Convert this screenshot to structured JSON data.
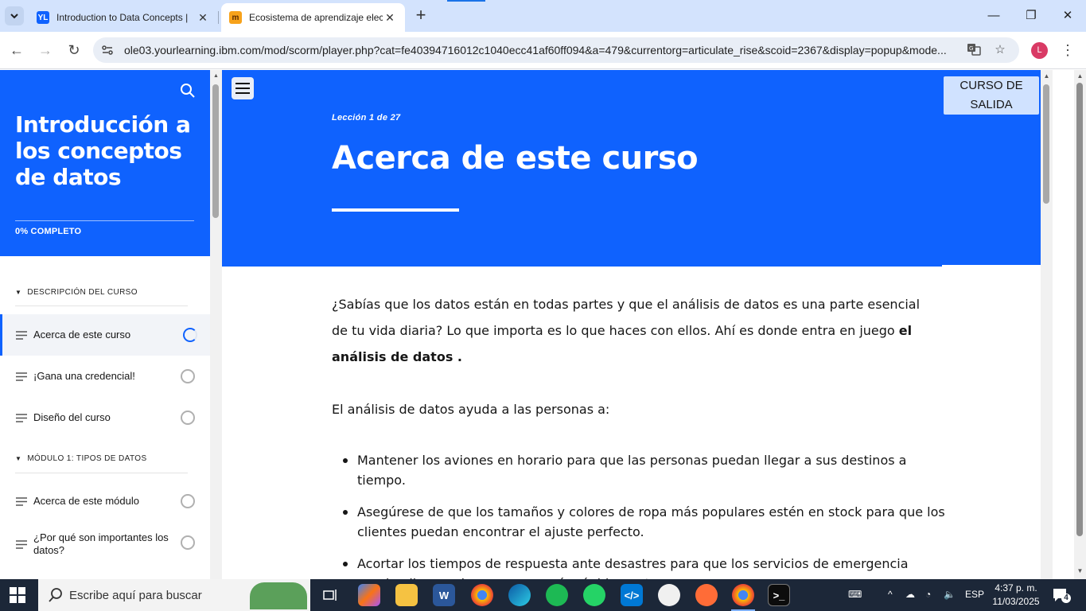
{
  "browser": {
    "tabs": [
      {
        "title": "Introduction to Data Concepts |",
        "favicon": "YL"
      },
      {
        "title": "Ecosistema de aprendizaje elect",
        "favicon": "m"
      }
    ],
    "url": "ole03.yourlearning.ibm.com/mod/scorm/player.php?cat=fe40394716012c1040ecc41af60ff094&a=479&currentorg=articulate_rise&scoid=2367&display=popup&mode...",
    "profile_initial": "L"
  },
  "sidebar": {
    "course_title": "Introducción a los conceptos de datos",
    "progress": "0% COMPLETO",
    "progress_fraction": 0,
    "sections": [
      {
        "label": "DESCRIPCIÓN DEL CURSO"
      },
      {
        "label": "MÓDULO 1: TIPOS DE DATOS"
      }
    ],
    "items": [
      {
        "label": "Acerca de este curso",
        "active": true
      },
      {
        "label": "¡Gana una credencial!"
      },
      {
        "label": "Diseño del curso"
      },
      {
        "label": "Acerca de este módulo"
      },
      {
        "label": "¿Por qué son importantes los datos?"
      }
    ]
  },
  "lesson": {
    "exit_label": "CURSO DE SALIDA",
    "counter": "Lección 1 de 27",
    "title": "Acerca de este curso",
    "para1_a": "¿Sabías que los datos están en todas partes y que el análisis de datos es una parte esencial de tu vida diaria? Lo que importa es lo que haces con ellos. Ahí es donde entra en juego ",
    "para1_bold": "el análisis de datos .",
    "para2": "El análisis de datos ayuda a las personas a:",
    "bullets": [
      "Mantener los aviones en horario para que las personas puedan llegar a sus destinos a tiempo.",
      "Asegúrese de que los tamaños y colores de ropa más populares estén en stock para que los clientes puedan encontrar el ajuste perfecto.",
      "Acortar los tiempos de respuesta ante desastres para que los servicios de emergencia puedan llegar a las personas más rápidamente"
    ]
  },
  "taskbar": {
    "search_placeholder": "Escribe aquí para buscar",
    "language": "ESP",
    "time": "4:37 p. m.",
    "date": "11/03/2025",
    "notifications": "4"
  },
  "colors": {
    "brand_blue": "#0f62fe",
    "exit_button": "#d0e2ff",
    "tab_strip": "#d3e3fd"
  }
}
